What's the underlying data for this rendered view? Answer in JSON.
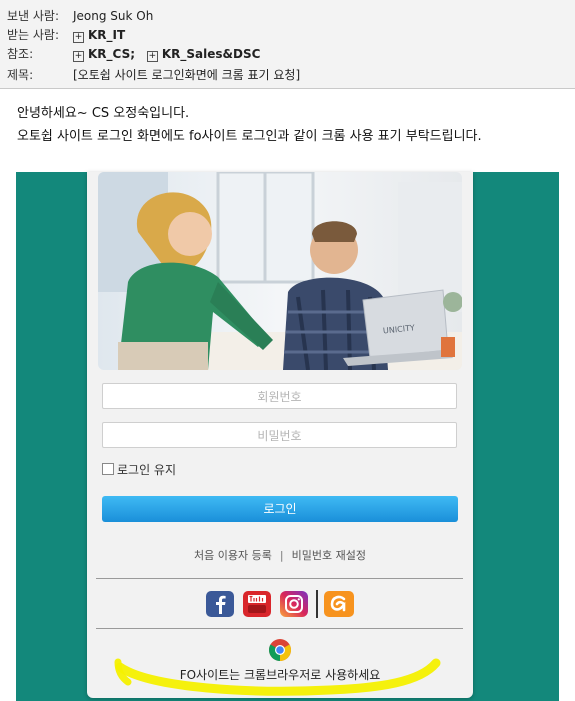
{
  "email": {
    "from_label": "보낸 사람:",
    "from_value": "Jeong Suk Oh",
    "to_label": "받는 사람:",
    "to_recipients": [
      "KR_IT"
    ],
    "cc_label": "참조:",
    "cc_recipients": [
      "KR_CS;",
      "KR_Sales&DSC"
    ],
    "subject_label": "제목:",
    "subject_value": "[오토쉽 사이트 로그인화면에 크롬 표기 요청]",
    "body_line1": "안녕하세요~ CS 오정숙입니다.",
    "body_line2": "오토쉽 사이트 로그인 화면에도 fo사이트 로그인과 같이 크롬 사용 표기 부탁드립니다."
  },
  "login": {
    "laptop_brand": "UNICITY",
    "member_id_placeholder": "회원번호",
    "password_placeholder": "비밀번호",
    "remember_label": "로그인 유지",
    "login_button": "로그인",
    "first_time_link": "처음 이용자 등록",
    "link_separator": "|",
    "reset_password_link": "비밀번호 재설정",
    "chrome_notice": "FO사이트는 크롬브라우저로 사용하세요"
  },
  "icons": {
    "facebook": "facebook-icon",
    "youtube": "youtube-icon",
    "instagram": "instagram-icon",
    "brand_app": "brand-app-icon",
    "chrome": "chrome-icon",
    "recipient_expand": "plus-box-icon"
  },
  "colors": {
    "background_teal": "#13887b",
    "button_blue": "#1a8fd9",
    "highlight_yellow": "#f4f000",
    "facebook_blue": "#3b5998",
    "youtube_red": "#d9262b",
    "brand_orange": "#f7931e"
  }
}
